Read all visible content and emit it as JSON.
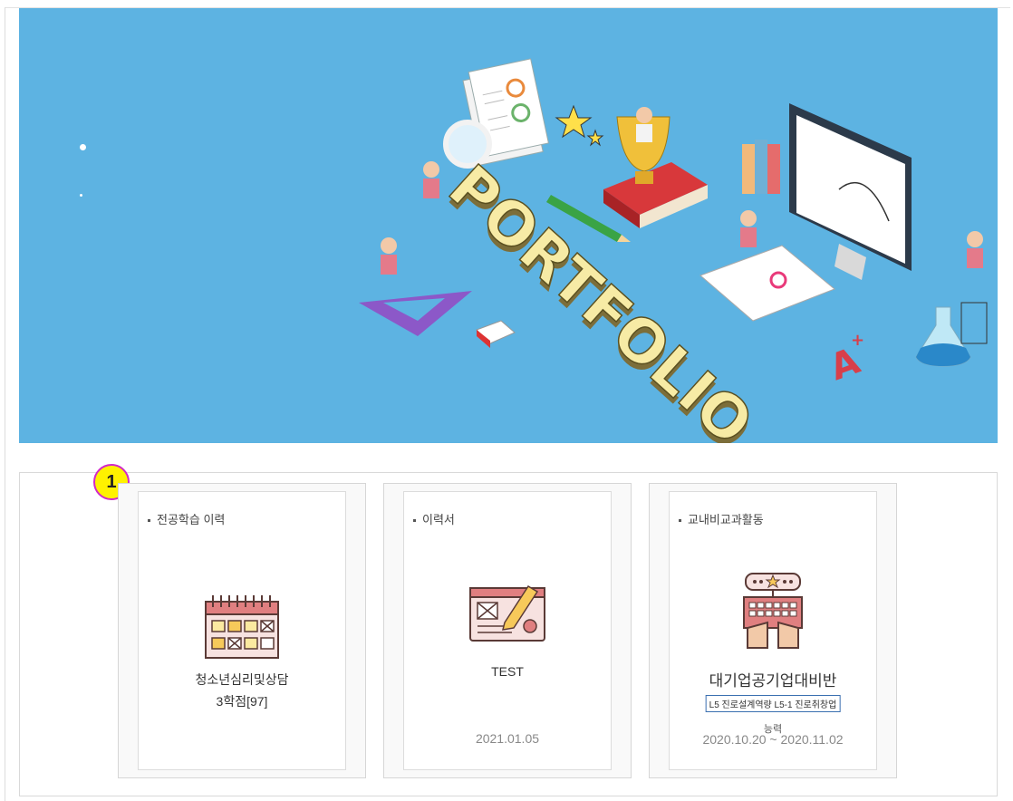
{
  "banner": {
    "illustration_text": "PORTFOLIO",
    "background_color": "#5db3e2"
  },
  "step_badge": "1",
  "cards": [
    {
      "title": "전공학습 이력",
      "icon": "calendar-icon",
      "line1": "청소년심리및상담",
      "line2": "3학점[97]"
    },
    {
      "title": "이력서",
      "icon": "resume-document-icon",
      "line1": "TEST",
      "date": "2021.01.05"
    },
    {
      "title": "교내비교과활동",
      "icon": "keyboard-activity-icon",
      "line1": "대기업공기업대비반",
      "tag": "L5 진로설계역량 L5-1 진로취창업",
      "tag_overflow": "능력",
      "date": "2020.10.20 ~ 2020.11.02"
    }
  ]
}
